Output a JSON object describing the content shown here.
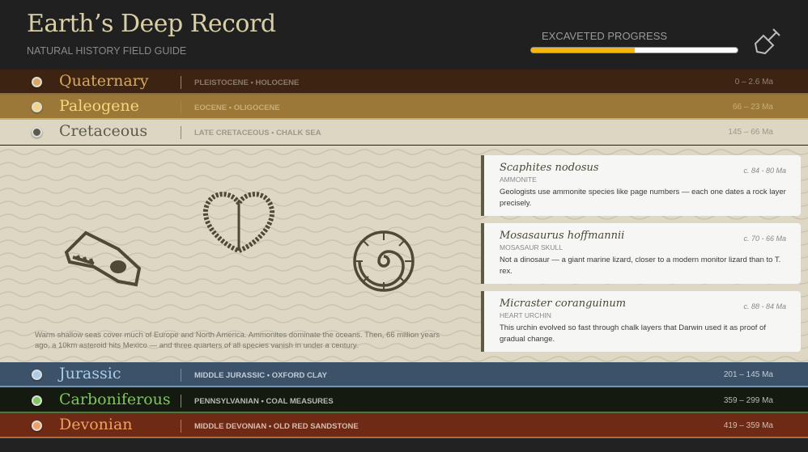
{
  "header": {
    "title": "Earth’s Deep Record",
    "subtitle": "NATURAL HISTORY FIELD GUIDE",
    "progress_label": "EXCAVETED PROGRESS",
    "progress_percent": 50,
    "progress_color": "#f5b50a",
    "tool_icon": "shovel-icon"
  },
  "periods": [
    {
      "name": "Quaternary",
      "sub": "PLEISTOCENE • HOLOCENE",
      "range": "0 – 2.6 Ma",
      "bg": "#3d2412",
      "fg": "#d9a85c",
      "dot": "#d9a85c",
      "subc": "#8a7a6a",
      "rangec": "#8d8378"
    },
    {
      "name": "Paleogene",
      "sub": "EOCENE • OLIGOCENE",
      "range": "66 – 23 Ma",
      "bg": "#9c7838",
      "fg": "#f3d77f",
      "dot": "#f3d77f",
      "subc": "#c6ad7a",
      "rangec": "#c6ad7a"
    },
    {
      "name": "Cretaceous",
      "sub": "LATE CRETACEOUS • CHALK SEA",
      "range": "145 – 66 Ma",
      "bg": "#dcd6c2",
      "fg": "#5c5a4a",
      "dot": "#5c5a4a",
      "subc": "#9c988a",
      "rangec": "#9c988a"
    },
    {
      "name": "Jurassic",
      "sub": "MIDDLE JURASSIC • OXFORD CLAY",
      "range": "201 – 145 Ma",
      "bg": "#3b5268",
      "fg": "#a9cde8",
      "dot": "#a9cde8",
      "subc": "#c3cdd6",
      "rangec": "#c3cdd6"
    },
    {
      "name": "Carboniferous",
      "sub": "PENNSYLVANIAN • COAL MEASURES",
      "range": "359 – 299 Ma",
      "bg": "#141a10",
      "fg": "#7dc85a",
      "dot": "#7dc85a",
      "subc": "#b5bcb0",
      "rangec": "#b5bcb0"
    },
    {
      "name": "Devonian",
      "sub": "MIDDLE DEVONIAN • OLD RED SANDSTONE",
      "range": "419 – 359 Ma",
      "bg": "#6e2a14",
      "fg": "#f0a060",
      "dot": "#f0a060",
      "subc": "#d8bdb0",
      "rangec": "#d8bdb0"
    }
  ],
  "expanded": {
    "description": "Warm shallow seas cover much of Europe and North America. Ammonites dominate the oceans. Then, 66 million years ago, a 10km asteroid hits Mexico — and three quarters of all species vanish in under a century.",
    "icons": [
      "mosasaur-skull-icon",
      "heart-urchin-icon",
      "ammonite-icon"
    ],
    "fossils": [
      {
        "species": "Scaphites nodosus",
        "age": "c. 84 - 80 Ma",
        "kind": "AMMONITE",
        "text": "Geologists use ammonite species like page numbers — each one dates a rock layer precisely."
      },
      {
        "species": "Mosasaurus hoffmannii",
        "age": "c. 70 - 66 Ma",
        "kind": "MOSASAUR SKULL",
        "text": "Not a dinosaur — a giant marine lizard, closer to a modern monitor lizard than to T. rex."
      },
      {
        "species": "Micraster coranguinum",
        "age": "c. 88 - 84 Ma",
        "kind": "HEART URCHIN",
        "text": "This urchin evolved so fast through chalk layers that Darwin used it as proof of gradual change."
      }
    ]
  }
}
